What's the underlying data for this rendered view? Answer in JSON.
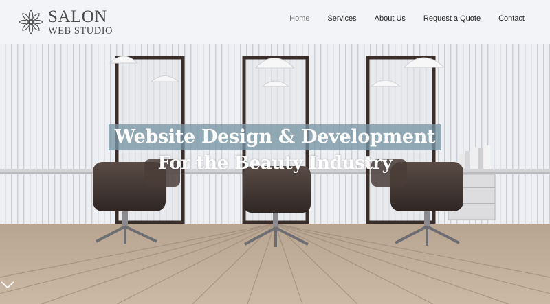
{
  "brand": {
    "line1": "SALON",
    "line2": "WEB STUDIO",
    "icon": "flower-logo-icon",
    "color": "#4a4a4a"
  },
  "nav": {
    "items": [
      {
        "label": "Home",
        "active": true
      },
      {
        "label": "Services",
        "active": false
      },
      {
        "label": "About Us",
        "active": false
      },
      {
        "label": "Request a Quote",
        "active": false
      },
      {
        "label": "Contact",
        "active": false
      }
    ]
  },
  "hero": {
    "headline_line1": "Website Design & Development",
    "headline_line2": "For the Beauty Industry",
    "highlight_color": "#7896a5",
    "scroll_icon": "chevron-down-icon"
  }
}
